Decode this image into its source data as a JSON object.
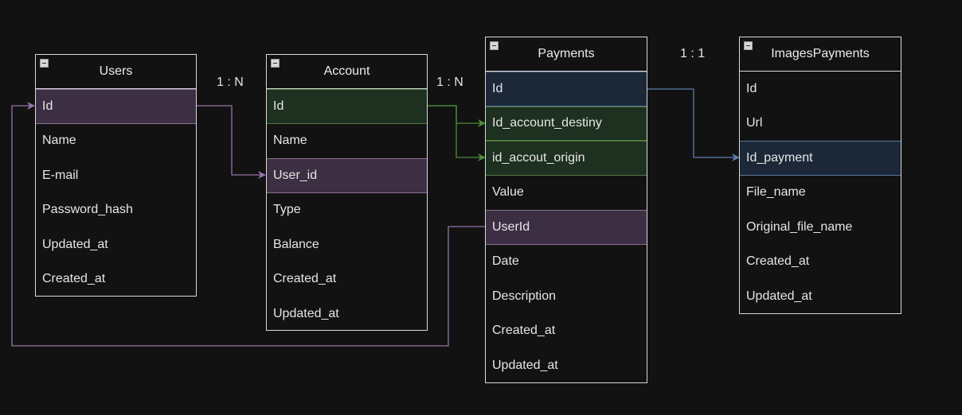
{
  "entities": [
    {
      "name": "Users",
      "fields": [
        "Id",
        "Name",
        "E-mail",
        "Password_hash",
        "Updated_at",
        "Created_at"
      ]
    },
    {
      "name": "Account",
      "fields": [
        "Id",
        "Name",
        "User_id",
        "Type",
        "Balance",
        "Created_at",
        "Updated_at"
      ]
    },
    {
      "name": "Payments",
      "fields": [
        "Id",
        "Id_account_destiny",
        "id_accout_origin",
        "Value",
        "UserId",
        "Date",
        "Description",
        "Created_at",
        "Updated_at"
      ]
    },
    {
      "name": "ImagesPayments",
      "fields": [
        "Id",
        "Url",
        "Id_payment",
        "File_name",
        "Original_file_name",
        "Created_at",
        "Updated_at"
      ]
    }
  ],
  "cardinalities": {
    "users_account": "1 : N",
    "account_payments": "1 : N",
    "payments_images": "1 : 1"
  },
  "colors": {
    "background": "#121212",
    "border": "#d9d9d9",
    "purple_link": "#9673a6",
    "green_link": "#4e8a3a",
    "blue_link": "#5b7fa8"
  }
}
